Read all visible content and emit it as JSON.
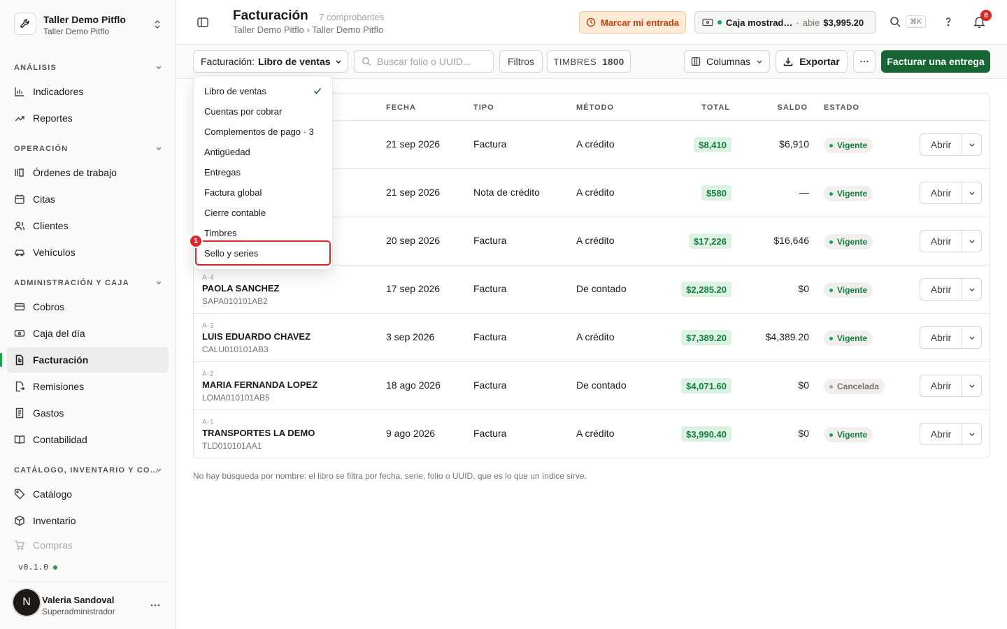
{
  "sidebar": {
    "brand_title": "Taller Demo Pitflo",
    "brand_subtitle": "Taller Demo Pitflo",
    "sections": {
      "analisis": "ANÁLISIS",
      "operacion": "OPERACIÓN",
      "administracion": "ADMINISTRACIÓN Y CAJA",
      "catalogo": "CATÁLOGO, INVENTARIO Y CO…"
    },
    "items": {
      "indicadores": "Indicadores",
      "reportes": "Reportes",
      "ordenes": "Órdenes de trabajo",
      "citas": "Citas",
      "clientes": "Clientes",
      "vehiculos": "Vehículos",
      "cobros": "Cobros",
      "caja": "Caja del día",
      "facturacion": "Facturación",
      "remisiones": "Remisiones",
      "gastos": "Gastos",
      "contabilidad": "Contabilidad",
      "catalogo": "Catálogo",
      "inventario": "Inventario",
      "compras": "Compras"
    },
    "version": "v0.1.0",
    "user": {
      "initial": "N",
      "name": "Valeria Sandoval",
      "role": "Superadministrador"
    }
  },
  "header": {
    "title": "Facturación",
    "count": "7 comprobantes",
    "breadcrumb": "Taller Demo Pitflo › Taller Demo Pitflo",
    "clock_label": "Marcar mi entrada",
    "caja_name": "Caja mostrad…",
    "caja_status": "abie",
    "caja_amount": "$3,995.20",
    "shortcut": "⌘K",
    "notifications": "8"
  },
  "toolbar": {
    "view_key": "Facturación:",
    "view_value": "Libro de ventas",
    "search_placeholder": "Buscar folio o UUID...",
    "filters": "Filtros",
    "timbres_label": "TIMBRES",
    "timbres_value": "1800",
    "columns": "Columnas",
    "export": "Exportar",
    "primary": "Facturar una entrega"
  },
  "table": {
    "headers": {
      "fecha": "FECHA",
      "tipo": "TIPO",
      "metodo": "MÉTODO",
      "total": "TOTAL",
      "saldo": "SALDO",
      "estado": "ESTADO"
    },
    "open_label": "Abrir",
    "rows": [
      {
        "folio": "",
        "client": "",
        "rfc": "",
        "fecha": "21 sep 2026",
        "tipo": "Factura",
        "metodo": "A crédito",
        "total": "$8,410",
        "saldo": "$6,910",
        "estado": "Vigente"
      },
      {
        "folio": "",
        "client": "",
        "rfc": "",
        "fecha": "21 sep 2026",
        "tipo": "Nota de crédito",
        "metodo": "A crédito",
        "total": "$580",
        "saldo": "—",
        "estado": "Vigente"
      },
      {
        "folio": "",
        "client": "",
        "rfc": "",
        "fecha": "20 sep 2026",
        "tipo": "Factura",
        "metodo": "A crédito",
        "total": "$17,226",
        "saldo": "$16,646",
        "estado": "Vigente"
      },
      {
        "folio": "A-4",
        "client": "PAOLA SANCHEZ",
        "rfc": "SAPA010101AB2",
        "fecha": "17 sep 2026",
        "tipo": "Factura",
        "metodo": "De contado",
        "total": "$2,285.20",
        "saldo": "$0",
        "estado": "Vigente"
      },
      {
        "folio": "A-3",
        "client": "LUIS EDUARDO CHAVEZ",
        "rfc": "CALU010101AB3",
        "fecha": "3 sep 2026",
        "tipo": "Factura",
        "metodo": "A crédito",
        "total": "$7,389.20",
        "saldo": "$4,389.20",
        "estado": "Vigente"
      },
      {
        "folio": "A-2",
        "client": "MARIA FERNANDA LOPEZ",
        "rfc": "LOMA010101AB5",
        "fecha": "18 ago 2026",
        "tipo": "Factura",
        "metodo": "De contado",
        "total": "$4,071.60",
        "saldo": "$0",
        "estado": "Cancelada"
      },
      {
        "folio": "A-1",
        "client": "TRANSPORTES LA DEMO",
        "rfc": "TLD010101AA1",
        "fecha": "9 ago 2026",
        "tipo": "Factura",
        "metodo": "A crédito",
        "total": "$3,990.40",
        "saldo": "$0",
        "estado": "Vigente"
      }
    ]
  },
  "footnote": "No hay búsqueda por nombre: el libro se filtra por fecha, serie, folio o UUID, que es lo que un índice sirve.",
  "dropdown": {
    "items": [
      "Libro de ventas",
      "Cuentas por cobrar",
      "Complementos de pago · 3",
      "Antigüedad",
      "Entregas",
      "Factura global",
      "Cierre contable",
      "Timbres",
      "Sello y series"
    ],
    "highlight_marker": "1"
  },
  "colors": {
    "accent": "#166534",
    "active_bar": "#16a34a",
    "vigente_dot": "#16a34a",
    "cancelada_dot": "#a8a29e",
    "highlight": "#dc2626"
  }
}
